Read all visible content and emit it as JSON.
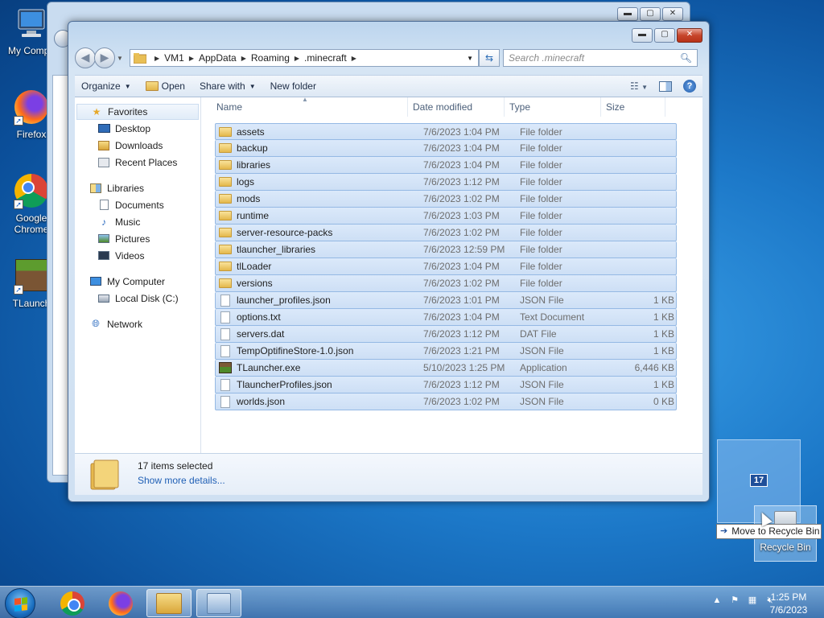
{
  "desktop": {
    "icons": [
      {
        "label": "My Compu"
      },
      {
        "label": "Firefox"
      },
      {
        "label": "Google Chrome"
      },
      {
        "label": "TLaunch"
      }
    ]
  },
  "window": {
    "caption": {
      "minimize": "▬",
      "maximize": "▢",
      "close": "✕"
    },
    "breadcrumb": [
      "VM1",
      "AppData",
      "Roaming",
      ".minecraft"
    ],
    "search_placeholder": "Search .minecraft",
    "toolbar": {
      "organize": "Organize",
      "open": "Open",
      "share_with": "Share with",
      "new_folder": "New folder"
    },
    "nav": {
      "favorites": "Favorites",
      "favorites_items": [
        "Desktop",
        "Downloads",
        "Recent Places"
      ],
      "libraries": "Libraries",
      "libraries_items": [
        "Documents",
        "Music",
        "Pictures",
        "Videos"
      ],
      "computer": "My Computer",
      "computer_items": [
        "Local Disk (C:)"
      ],
      "network": "Network"
    },
    "columns": {
      "name": "Name",
      "date": "Date modified",
      "type": "Type",
      "size": "Size"
    },
    "files": [
      {
        "name": "assets",
        "date": "7/6/2023 1:04 PM",
        "type": "File folder",
        "size": "",
        "kind": "folder"
      },
      {
        "name": "backup",
        "date": "7/6/2023 1:04 PM",
        "type": "File folder",
        "size": "",
        "kind": "folder"
      },
      {
        "name": "libraries",
        "date": "7/6/2023 1:04 PM",
        "type": "File folder",
        "size": "",
        "kind": "folder"
      },
      {
        "name": "logs",
        "date": "7/6/2023 1:12 PM",
        "type": "File folder",
        "size": "",
        "kind": "folder"
      },
      {
        "name": "mods",
        "date": "7/6/2023 1:02 PM",
        "type": "File folder",
        "size": "",
        "kind": "folder"
      },
      {
        "name": "runtime",
        "date": "7/6/2023 1:03 PM",
        "type": "File folder",
        "size": "",
        "kind": "folder"
      },
      {
        "name": "server-resource-packs",
        "date": "7/6/2023 1:02 PM",
        "type": "File folder",
        "size": "",
        "kind": "folder"
      },
      {
        "name": "tlauncher_libraries",
        "date": "7/6/2023 12:59 PM",
        "type": "File folder",
        "size": "",
        "kind": "folder"
      },
      {
        "name": "tlLoader",
        "date": "7/6/2023 1:04 PM",
        "type": "File folder",
        "size": "",
        "kind": "folder"
      },
      {
        "name": "versions",
        "date": "7/6/2023 1:02 PM",
        "type": "File folder",
        "size": "",
        "kind": "folder"
      },
      {
        "name": "launcher_profiles.json",
        "date": "7/6/2023 1:01 PM",
        "type": "JSON File",
        "size": "1 KB",
        "kind": "file"
      },
      {
        "name": "options.txt",
        "date": "7/6/2023 1:04 PM",
        "type": "Text Document",
        "size": "1 KB",
        "kind": "file"
      },
      {
        "name": "servers.dat",
        "date": "7/6/2023 1:12 PM",
        "type": "DAT File",
        "size": "1 KB",
        "kind": "file"
      },
      {
        "name": "TempOptifineStore-1.0.json",
        "date": "7/6/2023 1:21 PM",
        "type": "JSON File",
        "size": "1 KB",
        "kind": "file"
      },
      {
        "name": "TLauncher.exe",
        "date": "5/10/2023 1:25 PM",
        "type": "Application",
        "size": "6,446 KB",
        "kind": "app"
      },
      {
        "name": "TlauncherProfiles.json",
        "date": "7/6/2023 1:12 PM",
        "type": "JSON File",
        "size": "1 KB",
        "kind": "file"
      },
      {
        "name": "worlds.json",
        "date": "7/6/2023 1:02 PM",
        "type": "JSON File",
        "size": "0 KB",
        "kind": "file"
      }
    ],
    "details": {
      "count": "17 items selected",
      "more": "Show more details..."
    }
  },
  "drag": {
    "count": "17",
    "tooltip": "Move to Recycle Bin",
    "recycle_label": "Recycle Bin"
  },
  "taskbar": {
    "time": "1:25 PM",
    "date": "7/6/2023"
  }
}
